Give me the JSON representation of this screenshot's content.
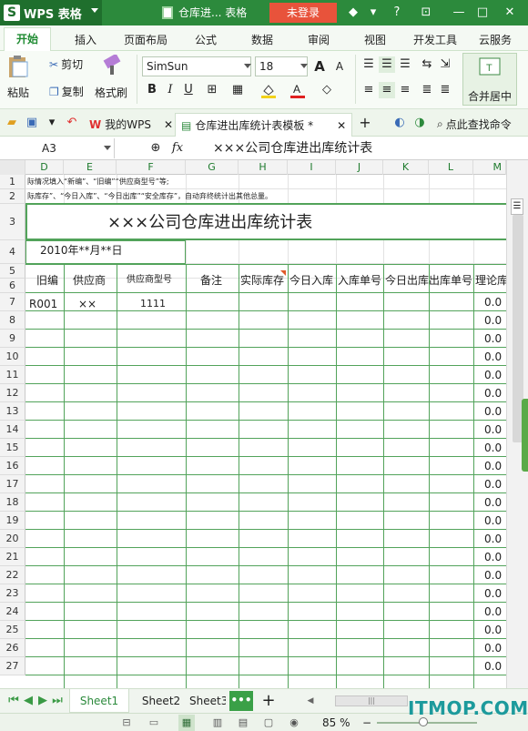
{
  "app": {
    "name": "WPS 表格",
    "doc_title": "仓库进... 表格",
    "login_label": "未登录"
  },
  "ribbon_tabs": [
    "开始",
    "插入",
    "页面布局",
    "公式",
    "数据",
    "审阅",
    "视图",
    "开发工具",
    "云服务"
  ],
  "ribbon": {
    "paste": "粘贴",
    "cut": "剪切",
    "copy": "复制",
    "format_painter": "格式刷",
    "font_name": "SimSun",
    "font_size": "18",
    "bold": "B",
    "italic": "I",
    "underline": "U",
    "merge_center": "合并居中"
  },
  "doc_tabs": {
    "my_wps": "我的WPS",
    "active": "仓库进出库统计表模板 *",
    "find_cmd": "点此查找命令"
  },
  "formula_bar": {
    "cell_ref": "A3",
    "fx": "fx",
    "content": "×××公司仓库进出库统计表"
  },
  "columns": [
    "D",
    "E",
    "F",
    "G",
    "H",
    "I",
    "J",
    "K",
    "L",
    "M"
  ],
  "rows": [
    "1",
    "2",
    "3",
    "4",
    "5",
    "6",
    "7",
    "8",
    "9",
    "10",
    "11",
    "12",
    "13",
    "14",
    "15",
    "16",
    "17",
    "18",
    "19",
    "20",
    "21",
    "22",
    "23",
    "24",
    "25",
    "26",
    "27"
  ],
  "sheet": {
    "row1_note": "际情况填入“新编”、“旧编”“供应商型号”等;",
    "row2_note": "际库存”、“今日入库”、“今日出库”“安全库存”，自动弃终统计出其他总量。",
    "title": "×××公司仓库进出库统计表",
    "date": "2010年**月**日",
    "headers": [
      "旧编",
      "供应商",
      "供应商型号",
      "备注",
      "实际库存",
      "今日入库",
      "入库单号",
      "今日出库",
      "出库单号",
      "理论库"
    ],
    "row7": {
      "old_code": "R001",
      "supplier": "××",
      "model": "1111"
    },
    "zero_value": "0.0"
  },
  "sheet_tabs": [
    "Sheet1",
    "Sheet2",
    "Sheet3"
  ],
  "status": {
    "zoom": "85 %"
  },
  "watermark": "ITMOP.COM"
}
